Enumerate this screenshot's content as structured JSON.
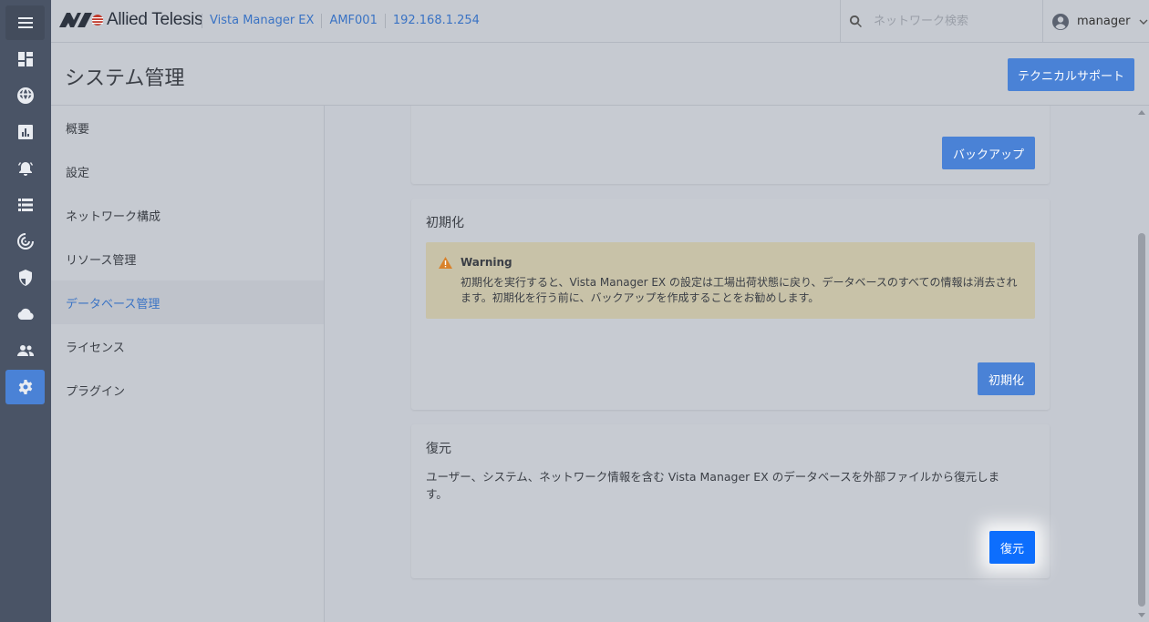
{
  "brand": {
    "name": "Allied Telesis"
  },
  "breadcrumbs": [
    "Vista Manager EX",
    "AMF001",
    "192.168.1.254"
  ],
  "search": {
    "placeholder": "ネットワーク検索"
  },
  "user": {
    "name": "manager"
  },
  "rail": {
    "icons": [
      "menu-icon",
      "dashboard-icon",
      "globe-icon",
      "chart-icon",
      "alarm-icon",
      "list-icon",
      "radar-icon",
      "shield-icon",
      "cloud-icon",
      "users-icon",
      "gear-icon"
    ],
    "active": "gear-icon"
  },
  "page": {
    "title": "システム管理",
    "tech_support_label": "テクニカルサポート"
  },
  "subnav": {
    "items": [
      "概要",
      "設定",
      "ネットワーク構成",
      "リソース管理",
      "データベース管理",
      "ライセンス",
      "プラグイン"
    ],
    "active_index": 4
  },
  "backup_card": {
    "button_label": "バックアップ"
  },
  "init_card": {
    "title": "初期化",
    "warning_title": "Warning",
    "warning_text": "初期化を実行すると、Vista Manager EX の設定は工場出荷状態に戻り、データベースのすべての情報は消去されます。初期化を行う前に、バックアップを作成することをお勧めします。",
    "button_label": "初期化"
  },
  "restore_card": {
    "title": "復元",
    "description": "ユーザー、システム、ネットワーク情報を含む Vista Manager EX のデータベースを外部ファイルから復元します。",
    "button_label": "復元"
  },
  "colors": {
    "accent": "#4a82d6",
    "primary_highlight": "#0d6efd",
    "rail": "#4a5466",
    "warning_bg": "#c8c2a8",
    "warning_icon": "#d9822b"
  }
}
